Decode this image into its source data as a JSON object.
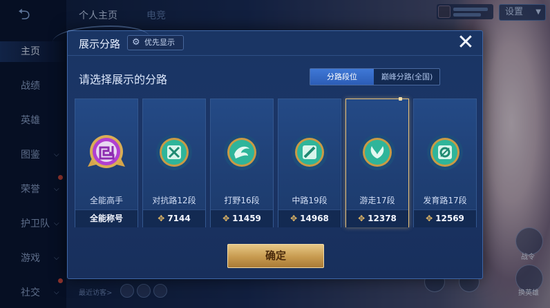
{
  "background": {
    "nav_items": [
      "主页",
      "战绩",
      "英雄",
      "图鉴",
      "荣誉",
      "护卫队",
      "游戏",
      "社交"
    ],
    "top_tabs": [
      "个人主页",
      "电竞"
    ],
    "settings_label": "设置",
    "recent_visitors_label": "最近访客>",
    "side_labels": [
      "战令",
      "换英雄"
    ]
  },
  "modal": {
    "title": "展示分路",
    "priority_label": "优先显示",
    "close_glyph": "✕",
    "subtitle": "请选择展示的分路",
    "toggle_options": [
      "分路段位",
      "巅峰分路(全国)"
    ],
    "toggle_selected": 0,
    "cards": [
      {
        "lane": "全能高手",
        "footer": "全能称号",
        "score": "",
        "icon": "all-round-emblem-icon",
        "selected": false
      },
      {
        "lane": "对抗路12段",
        "footer": "",
        "score": "7144",
        "icon": "clash-lane-emblem-icon",
        "selected": false
      },
      {
        "lane": "打野16段",
        "footer": "",
        "score": "11459",
        "icon": "jungle-emblem-icon",
        "selected": false
      },
      {
        "lane": "中路19段",
        "footer": "",
        "score": "14968",
        "icon": "mid-lane-emblem-icon",
        "selected": false
      },
      {
        "lane": "游走17段",
        "footer": "",
        "score": "12378",
        "icon": "roam-emblem-icon",
        "selected": true
      },
      {
        "lane": "发育路17段",
        "footer": "",
        "score": "12569",
        "icon": "farm-lane-emblem-icon",
        "selected": false
      }
    ],
    "confirm_label": "确定"
  },
  "colors": {
    "accent_gold": "#e8c27a",
    "toggle_selected": "#3f78d6",
    "emblem_green": "#2fb59a",
    "emblem_purple": "#b03fd1"
  }
}
